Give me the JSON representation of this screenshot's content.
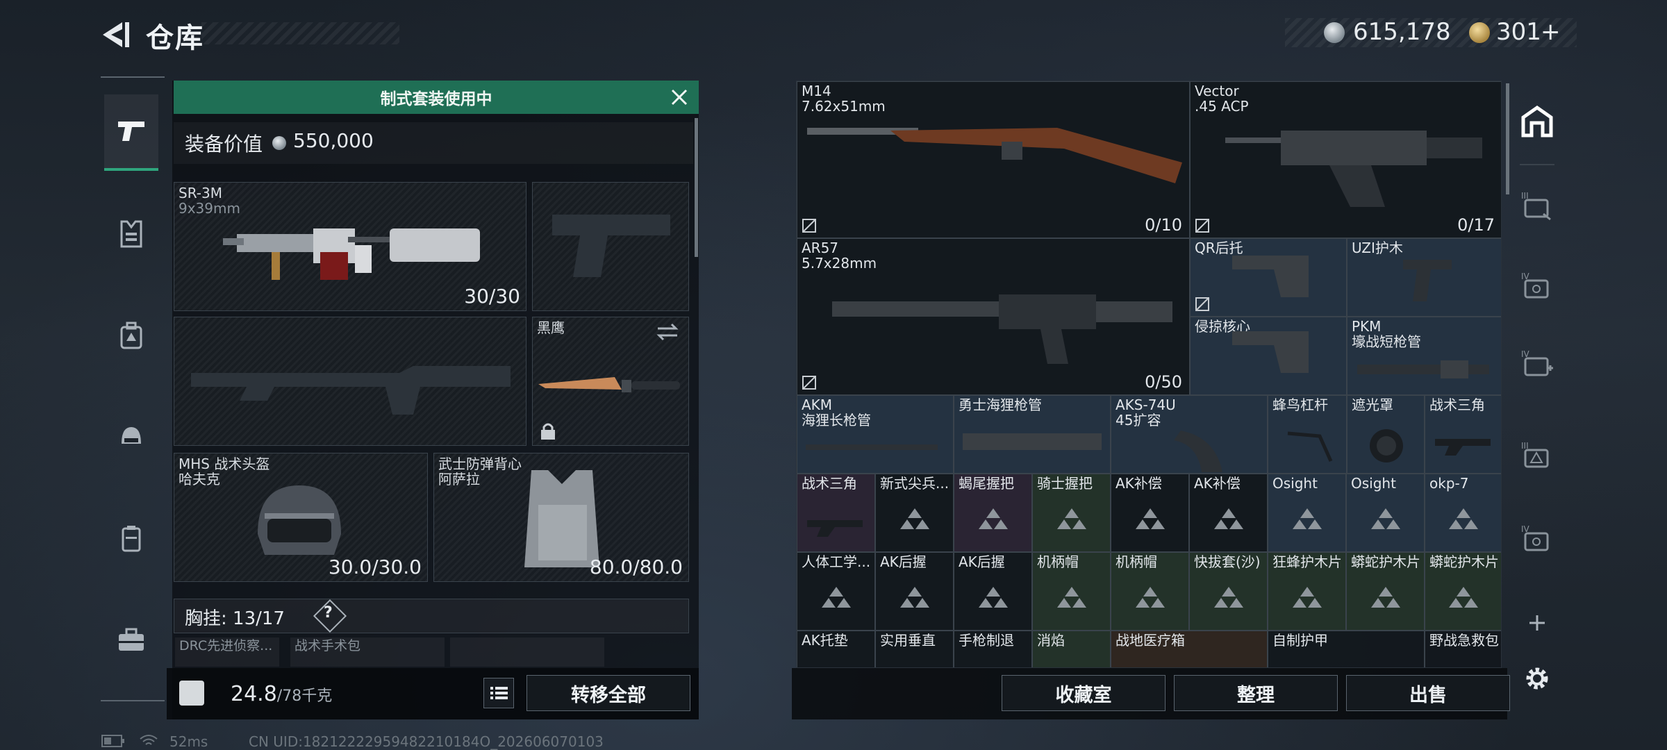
{
  "header": {
    "title": "仓库"
  },
  "currency": {
    "silver": "615,178",
    "gold": "301",
    "gold_add": "+"
  },
  "loadout": {
    "banner": "制式套装使用中",
    "value_label": "装备价值",
    "value": "550,000",
    "primary": {
      "name": "SR-3M",
      "caliber": "9x39mm",
      "count": "30/30"
    },
    "knife": {
      "name": "黑鹰"
    },
    "helmet": {
      "name": "MHS 战术头盔",
      "sub": "哈夫克",
      "durability": "30.0/30.0"
    },
    "armor": {
      "name": "武士防弹背心",
      "sub": "阿萨拉",
      "durability": "80.0/80.0"
    },
    "chest_label": "胸挂:",
    "chest_count": "13/17",
    "chest_help": "?",
    "chest_items": [
      "DRC先进侦察...",
      "战术手术包",
      ""
    ],
    "weight": "24.8",
    "weight_max": "/78千克",
    "transfer_all": "转移全部"
  },
  "storage": {
    "weapons": [
      {
        "name": "M14",
        "caliber": "7.62x51mm",
        "count": "0/10"
      },
      {
        "name": "Vector",
        "caliber": ".45 ACP",
        "count": "0/17"
      },
      {
        "name": "AR57",
        "caliber": "5.7x28mm",
        "count": "0/50"
      }
    ],
    "qr_stock": "QR后托",
    "uzi_guard": "UZI护木",
    "qinlue": "侵掠核心",
    "pkm": "PKM\n壕战短枪管",
    "row3": [
      "AKM\n海狸长枪管",
      "勇士海狸枪管",
      "AKS-74U\n45扩容",
      "蜂鸟杠杆",
      "遮光罩",
      "战术三角"
    ],
    "row4": [
      "战术三角",
      "新式尖兵...",
      "蝎尾握把",
      "骑士握把",
      "AK补偿",
      "AK补偿",
      "Osight",
      "Osight",
      "okp-7"
    ],
    "row5": [
      "人体工学...",
      "AK后握",
      "AK后握",
      "机柄帽",
      "机柄帽",
      "快拔套(沙)",
      "狂蜂护木片",
      "蟒蛇护木片",
      "蟒蛇护木片"
    ],
    "row6": [
      "AK托垫",
      "实用垂直",
      "手枪制退",
      "消焰",
      "战地医疗箱",
      "自制护甲",
      "野战急救包"
    ]
  },
  "actions": {
    "collection": "收藏室",
    "sort": "整理",
    "sell": "出售"
  },
  "status": {
    "ping": "52ms",
    "uid": "CN UID:18212222959482210184O_202606070103"
  },
  "colors": {
    "accent": "#1f6f55",
    "panel": "#0a0d11"
  }
}
